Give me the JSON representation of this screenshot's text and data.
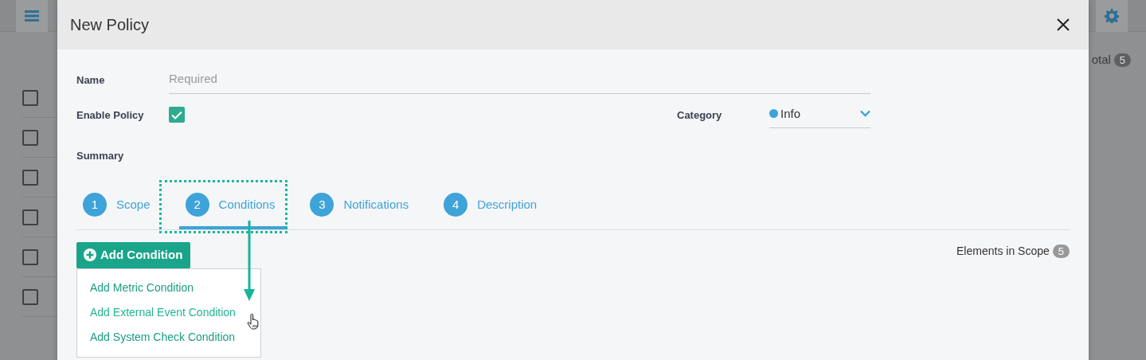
{
  "background": {
    "total_label": "otal",
    "total_count": "5",
    "rows": [
      {
        "checked": false
      },
      {
        "checked": false
      },
      {
        "checked": false
      },
      {
        "checked": false
      },
      {
        "checked": false
      },
      {
        "checked": false
      }
    ]
  },
  "modal": {
    "title": "New Policy",
    "name": {
      "label": "Name",
      "placeholder": "Required"
    },
    "enable_policy": {
      "label": "Enable Policy",
      "checked": true
    },
    "category": {
      "label": "Category",
      "value": "Info"
    },
    "summary_label": "Summary",
    "steps": [
      {
        "number": "1",
        "label": "Scope",
        "selected": false
      },
      {
        "number": "2",
        "label": "Conditions",
        "selected": true
      },
      {
        "number": "3",
        "label": "Notifications",
        "selected": false
      },
      {
        "number": "4",
        "label": "Description",
        "selected": false
      }
    ],
    "add_button": "Add Condition",
    "menu_items": [
      {
        "label": "Add Metric Condition",
        "hovered": false
      },
      {
        "label": "Add External Event Condition",
        "hovered": true
      },
      {
        "label": "Add System Check Condition",
        "hovered": false
      }
    ],
    "elements_in_scope": {
      "label": "Elements in Scope",
      "count": "5"
    }
  }
}
